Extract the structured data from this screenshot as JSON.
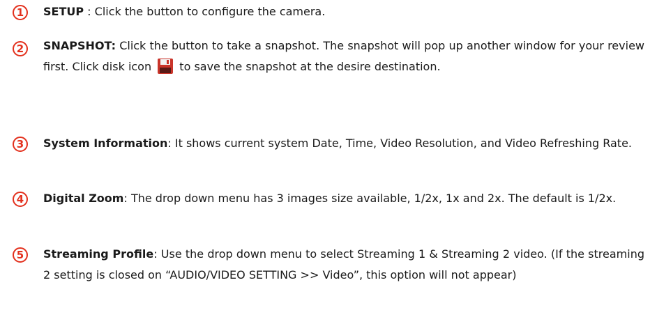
{
  "items": [
    {
      "number": "1",
      "term": "SETUP",
      "text": " :  Click the button to configure the camera."
    },
    {
      "number": "2",
      "term": "SNAPSHOT:",
      "text_before": "  Click the button to take a snapshot. The snapshot will pop up another window for your review first. Click disk icon",
      "icon": "disk-icon",
      "text_after": "to save the snapshot at the desire destination."
    },
    {
      "number": "3",
      "term": "System Information",
      "text": ": It shows current system Date, Time, Video Resolution, and Video Refreshing Rate."
    },
    {
      "number": "4",
      "term": "Digital Zoom",
      "text": ": The drop down menu has 3 images size available, 1/2x, 1x and 2x. The default is 1/2x."
    },
    {
      "number": "5",
      "term": "Streaming Profile",
      "text": ": Use the drop down menu to select Streaming 1 & Streaming 2 video. (If the streaming 2 setting is closed on “AUDIO/VIDEO SETTING >> Video”, this option will not appear)"
    }
  ],
  "colors": {
    "number_accent": "#e3301d",
    "icon_red": "#c9342a"
  }
}
